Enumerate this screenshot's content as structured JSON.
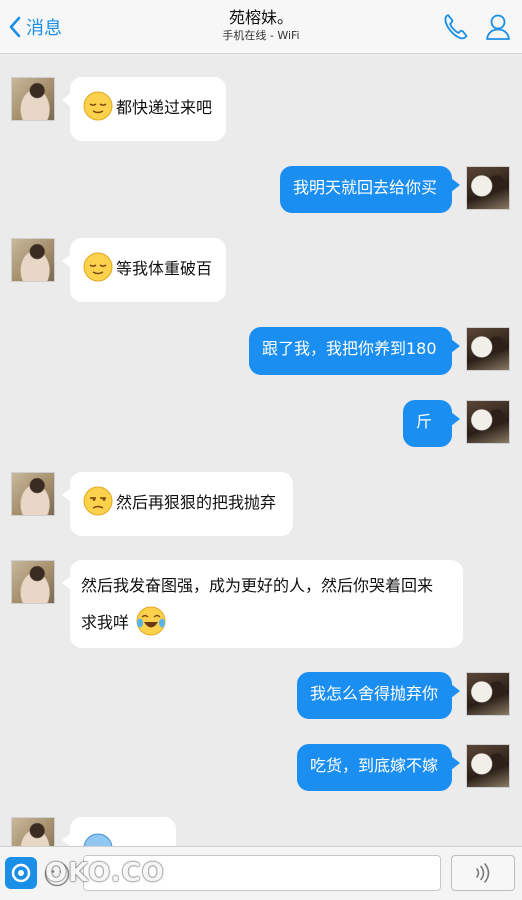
{
  "header": {
    "back_label": "消息",
    "title": "苑榕妹。",
    "subtitle": "手机在线 - WiFi"
  },
  "messages": [
    {
      "side": "in",
      "emoji": "relieved-emoji",
      "text": "都快递过来吧"
    },
    {
      "side": "out",
      "text": "我明天就回去给你买"
    },
    {
      "side": "in",
      "emoji": "relieved-emoji",
      "text": "等我体重破百"
    },
    {
      "side": "out",
      "text": "跟了我，我把你养到180"
    },
    {
      "side": "out",
      "text": "斤"
    },
    {
      "side": "in",
      "emoji": "unamused-emoji",
      "text": "然后再狠狠的把我抛弃"
    },
    {
      "side": "in",
      "line1": "然后我发奋图强，成为更好的人，然后你哭着回来",
      "line2": "求我咩",
      "emoji_after": "tears-of-joy-emoji"
    },
    {
      "side": "out",
      "text": "我怎么舍得抛弃你"
    },
    {
      "side": "out",
      "text": "吃货，到底嫁不嫁"
    },
    {
      "side": "in",
      "emoji": "blue-face-emoji",
      "text": ""
    }
  ],
  "input": {
    "placeholder": "",
    "value": ""
  },
  "watermark": "OKO.CO",
  "colors": {
    "accent": "#1a8fe8",
    "outgoing_bubble": "#1b8ef2",
    "incoming_bubble": "#ffffff",
    "background": "#ebebeb"
  },
  "icons": [
    "chevron-left-icon",
    "phone-icon",
    "profile-icon",
    "emoji-icon",
    "voice-icon"
  ]
}
